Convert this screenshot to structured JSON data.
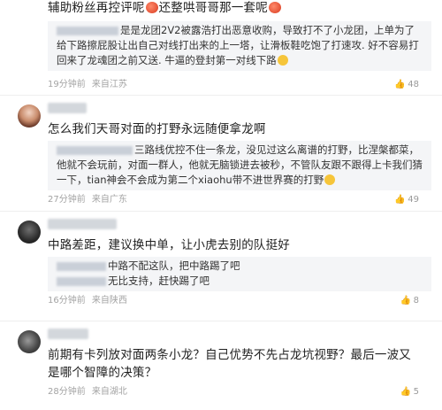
{
  "comments": [
    {
      "text_pre": "辅助粉丝再控评呢",
      "text_mid": "还整哄哥哥那一套呢",
      "quote": "是是龙团2V2被露浩打出恶意收购，导致打不了小龙团，上单为了给下路擦屁股让出自己对线打出来的上一塔，让滑板鞋吃饱了打速攻. 好不容易打回来了龙魂团之前又送. 牛逼的登封第一对线下路",
      "time": "19分钟前",
      "region": "来自江苏",
      "likes": "48"
    },
    {
      "text": "怎么我们天哥对面的打野永远随便拿龙啊",
      "quote": "三路线优控不住一条龙，没见过这么离谱的打野，比涅槃都菜，他就不会玩前，对面一群人，他就无脑锁进去被秒，不管队友跟不跟得上卡我们猜一下，tian神会不会成为第二个xiaohu带不进世界赛的打野",
      "time": "27分钟前",
      "region": "来自广东",
      "likes": "49"
    },
    {
      "text": "中路差距，建议换中单，让小虎去别的队挺好",
      "quote_line1": "中路不配这队，把中路踢了吧",
      "quote_line2": "无比支持，赶快踢了吧",
      "time": "16分钟前",
      "region": "来自陕西",
      "likes": "8"
    },
    {
      "text": "前期有卡列放对面两条小龙？自己优势不先占龙坑视野？最后一波又是哪个智障的决策？",
      "time": "28分钟前",
      "region": "来自湖北",
      "likes": "5"
    }
  ],
  "icons": {
    "emoji_blush": "blush-face-icon",
    "emoji_grin": "grin-face-icon",
    "like": "thumbs-up-icon"
  }
}
